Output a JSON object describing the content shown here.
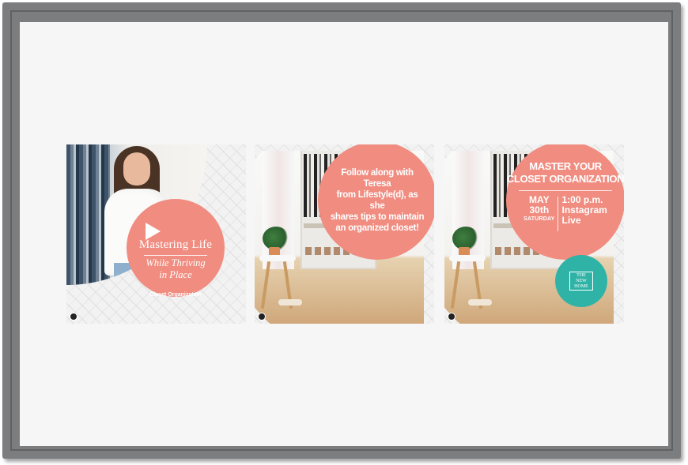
{
  "cards": [
    {
      "title": "Mastering Life",
      "subtitle_line1": "While Thriving",
      "subtitle_line2": "in Place",
      "caption": "Closet Organization",
      "play_icon": "play-icon"
    },
    {
      "line1": "Follow along with Teresa",
      "line2_pre": "from ",
      "line2_bold": "Lifestyle(d)",
      "line2_post": ", as she",
      "line3": "shares tips to maintain",
      "line4": "an organized closet!"
    },
    {
      "title_line1": "MASTER YOUR",
      "title_line2": "CLOSET ORGANIZATION",
      "date_month": "MAY",
      "date_day": "30th",
      "date_weekday": "SATURDAY",
      "time": "1:00 p.m.",
      "platform_line1": "Instagram",
      "platform_line2": "Live",
      "logo_line1": "THE",
      "logo_line2": "NEW",
      "logo_line3": "HOME"
    }
  ],
  "colors": {
    "salmon": "#f08c80",
    "teal": "#2fb3a7",
    "frame": "#7b7d7f"
  }
}
